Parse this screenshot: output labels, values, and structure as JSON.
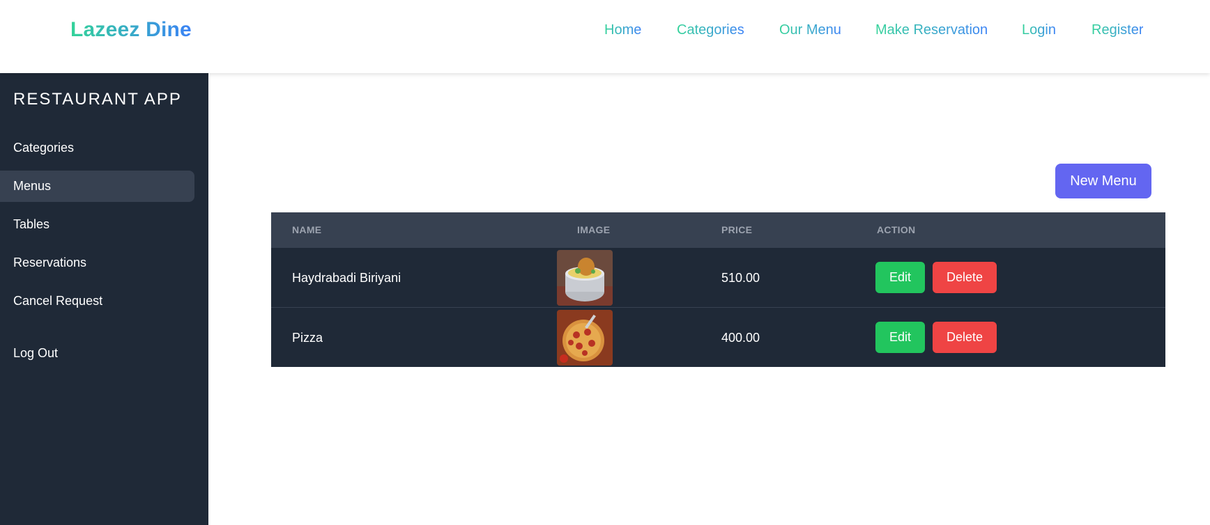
{
  "brand": "Lazeez Dine",
  "nav": [
    "Home",
    "Categories",
    "Our Menu",
    "Make Reservation",
    "Login",
    "Register"
  ],
  "sidebar": {
    "title": "RESTAURANT APP",
    "items": [
      "Categories",
      "Menus",
      "Tables",
      "Reservations",
      "Cancel Request"
    ],
    "active": "Menus",
    "logout": "Log Out"
  },
  "main": {
    "new_button": "New Menu",
    "columns": [
      "NAME",
      "IMAGE",
      "PRICE",
      "ACTION"
    ],
    "rows": [
      {
        "name": "Haydrabadi Biriyani",
        "image": "biriyani-dish-photo",
        "price": "510.00"
      },
      {
        "name": "Pizza",
        "image": "pepperoni-pizza-photo",
        "price": "400.00"
      }
    ],
    "edit_label": "Edit",
    "delete_label": "Delete"
  },
  "colors": {
    "brand_gradient_start": "#34d399",
    "brand_gradient_end": "#3b82f6",
    "sidebar_bg": "#1f2937",
    "sidebar_active": "#374151",
    "primary_button": "#6366f1",
    "edit_button": "#22c55e",
    "delete_button": "#ef4444"
  }
}
